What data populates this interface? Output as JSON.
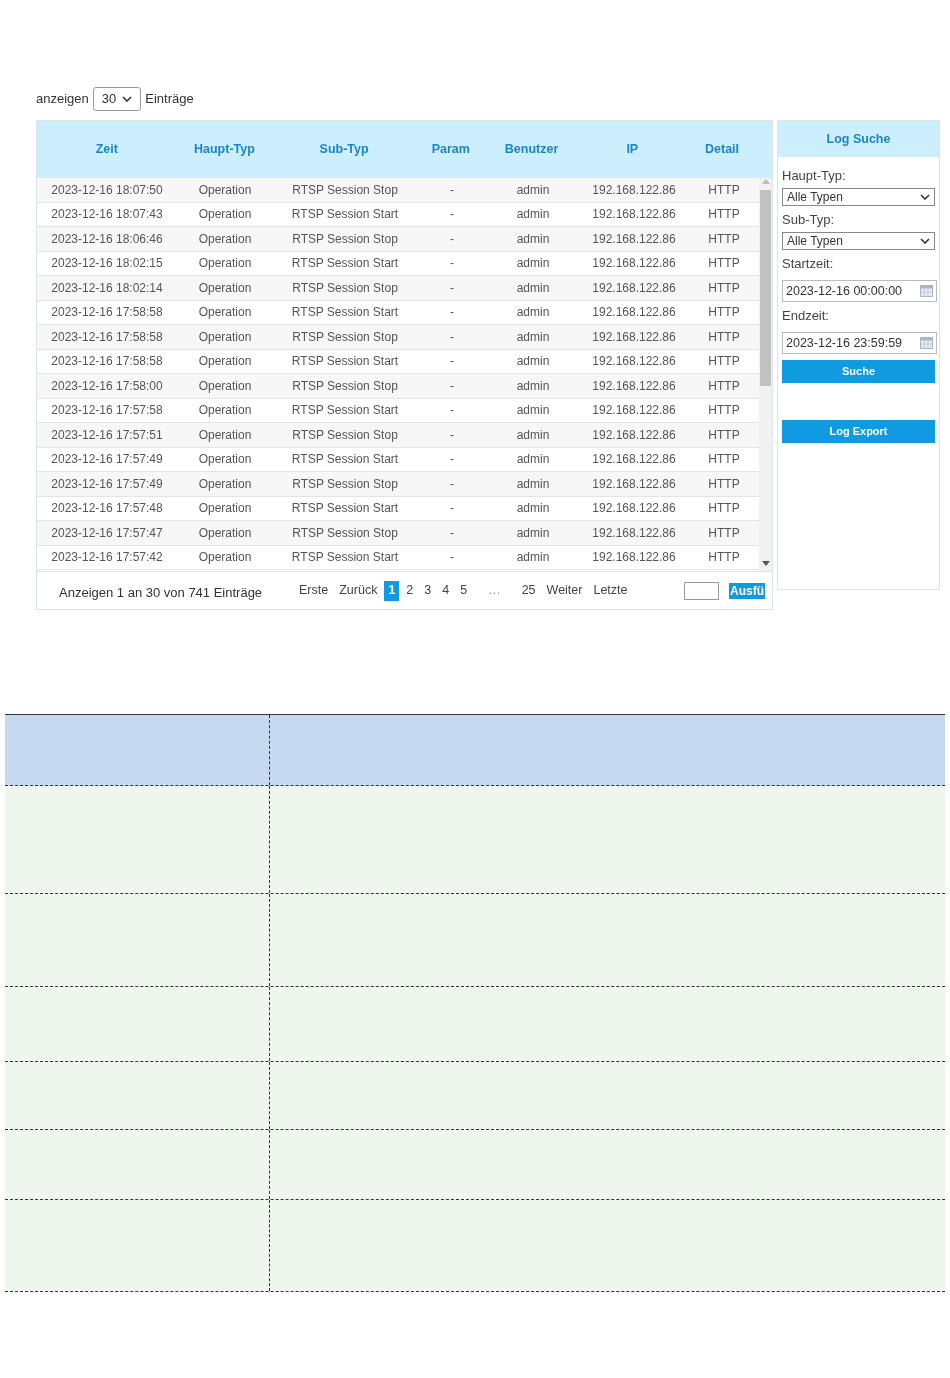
{
  "page_size": {
    "label_before": "anzeigen",
    "value": "30",
    "label_after": "Einträge"
  },
  "log_table": {
    "columns": [
      "Zeit",
      "Haupt-Typ",
      "Sub-Typ",
      "Param",
      "Benutzer",
      "IP",
      "Detail"
    ],
    "rows": [
      [
        "2023-12-16 18:07:50",
        "Operation",
        "RTSP Session Stop",
        "-",
        "admin",
        "192.168.122.86",
        "HTTP"
      ],
      [
        "2023-12-16 18:07:43",
        "Operation",
        "RTSP Session Start",
        "-",
        "admin",
        "192.168.122.86",
        "HTTP"
      ],
      [
        "2023-12-16 18:06:46",
        "Operation",
        "RTSP Session Stop",
        "-",
        "admin",
        "192.168.122.86",
        "HTTP"
      ],
      [
        "2023-12-16 18:02:15",
        "Operation",
        "RTSP Session Start",
        "-",
        "admin",
        "192.168.122.86",
        "HTTP"
      ],
      [
        "2023-12-16 18:02:14",
        "Operation",
        "RTSP Session Stop",
        "-",
        "admin",
        "192.168.122.86",
        "HTTP"
      ],
      [
        "2023-12-16 17:58:58",
        "Operation",
        "RTSP Session Start",
        "-",
        "admin",
        "192.168.122.86",
        "HTTP"
      ],
      [
        "2023-12-16 17:58:58",
        "Operation",
        "RTSP Session Stop",
        "-",
        "admin",
        "192.168.122.86",
        "HTTP"
      ],
      [
        "2023-12-16 17:58:58",
        "Operation",
        "RTSP Session Start",
        "-",
        "admin",
        "192.168.122.86",
        "HTTP"
      ],
      [
        "2023-12-16 17:58:00",
        "Operation",
        "RTSP Session Stop",
        "-",
        "admin",
        "192.168.122.86",
        "HTTP"
      ],
      [
        "2023-12-16 17:57:58",
        "Operation",
        "RTSP Session Start",
        "-",
        "admin",
        "192.168.122.86",
        "HTTP"
      ],
      [
        "2023-12-16 17:57:51",
        "Operation",
        "RTSP Session Stop",
        "-",
        "admin",
        "192.168.122.86",
        "HTTP"
      ],
      [
        "2023-12-16 17:57:49",
        "Operation",
        "RTSP Session Start",
        "-",
        "admin",
        "192.168.122.86",
        "HTTP"
      ],
      [
        "2023-12-16 17:57:49",
        "Operation",
        "RTSP Session Stop",
        "-",
        "admin",
        "192.168.122.86",
        "HTTP"
      ],
      [
        "2023-12-16 17:57:48",
        "Operation",
        "RTSP Session Start",
        "-",
        "admin",
        "192.168.122.86",
        "HTTP"
      ],
      [
        "2023-12-16 17:57:47",
        "Operation",
        "RTSP Session Stop",
        "-",
        "admin",
        "192.168.122.86",
        "HTTP"
      ],
      [
        "2023-12-16 17:57:42",
        "Operation",
        "RTSP Session Start",
        "-",
        "admin",
        "192.168.122.86",
        "HTTP"
      ]
    ],
    "info": "Anzeigen 1 an 30 von 741 Einträge",
    "pagination": [
      {
        "label": "Erste",
        "selected": false
      },
      {
        "label": "Zurück",
        "selected": false
      },
      {
        "label": "1",
        "selected": true
      },
      {
        "label": "2",
        "selected": false
      },
      {
        "label": "3",
        "selected": false
      },
      {
        "label": "4",
        "selected": false
      },
      {
        "label": "5",
        "selected": false
      },
      {
        "label": "…",
        "selected": false
      },
      {
        "label": "25",
        "selected": false
      },
      {
        "label": "Weiter",
        "selected": false
      },
      {
        "label": "Letzte",
        "selected": false
      }
    ],
    "go_button": "Ausfü"
  },
  "search_panel": {
    "title": "Log Suche",
    "fields": [
      {
        "kind": "select",
        "label": "Haupt-Typ:",
        "value": "Alle Typen"
      },
      {
        "kind": "select",
        "label": "Sub-Typ:",
        "value": "Alle Typen"
      },
      {
        "kind": "date",
        "label": "Startzeit:",
        "value": "2023-12-16 00:00:00"
      },
      {
        "kind": "date",
        "label": "Endzeit:",
        "value": "2023-12-16 23:59:59"
      }
    ],
    "buttons": [
      "Suche",
      "Log Export"
    ]
  }
}
